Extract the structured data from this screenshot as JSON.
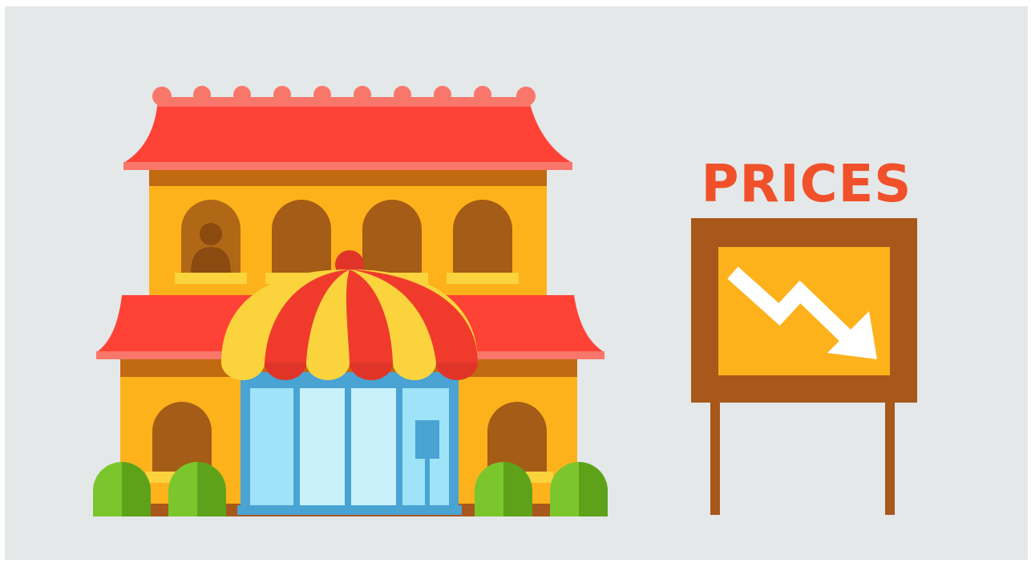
{
  "sign": {
    "label": "PRICES",
    "trend": "down-arrow-icon"
  },
  "colors": {
    "background": "#e4e8e9",
    "roof": "#ff4236",
    "roof_trim": "#f8776a",
    "wall": "#fdb21c",
    "window": "#a55c16",
    "awning_red": "#f03b2c",
    "awning_yellow": "#fbd43d",
    "glass": "#9ee3f7",
    "glass_frame": "#49a3d3",
    "bush": "#7bc62c",
    "sign_frame": "#a8581a",
    "sign_panel": "#fdb21c",
    "label": "#f0512a"
  }
}
